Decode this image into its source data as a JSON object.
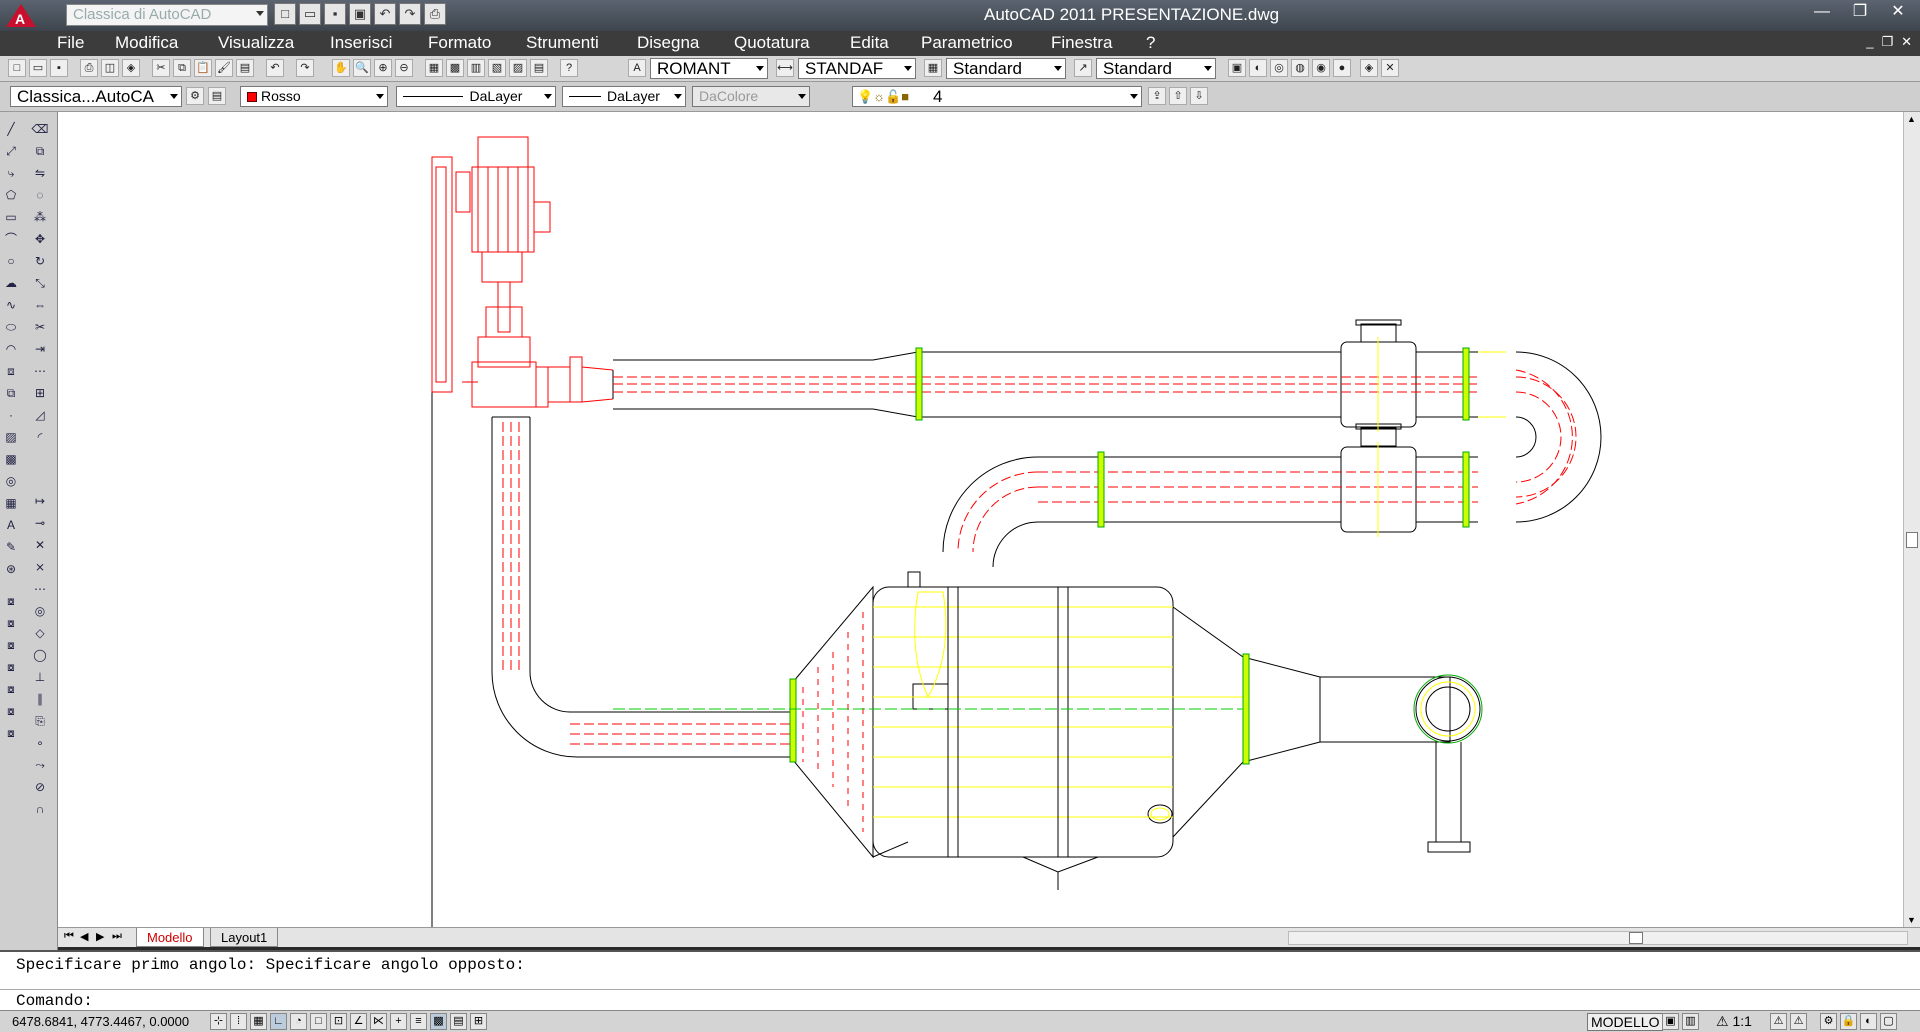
{
  "titlebar": {
    "workspace": "Classica di AutoCAD",
    "title": "AutoCAD 2011    PRESENTAZIONE.dwg",
    "qat_icons": [
      "new-icon",
      "open-icon",
      "save-icon",
      "saveas-icon",
      "undo-icon",
      "redo-icon",
      "print-icon"
    ]
  },
  "menu": {
    "items": [
      "File",
      "Modifica",
      "Visualizza",
      "Inserisci",
      "Formato",
      "Strumenti",
      "Disegna",
      "Quotatura",
      "Edita",
      "Parametrico",
      "Finestra",
      "?"
    ]
  },
  "toolbar1": {
    "text_style": "ROMANT",
    "dim_style": "STANDAF",
    "table_style": "Standard",
    "multileader_style": "Standard"
  },
  "toolbar2": {
    "workspace": "Classica...AutoCA",
    "color": "Rosso",
    "color_hex": "#ff0000",
    "linetype": "DaLayer",
    "lineweight": "DaLayer",
    "plotstyle": "DaColore",
    "layer": "4"
  },
  "tabs": {
    "model": "Modello",
    "layout": "Layout1"
  },
  "command": {
    "history": "Specificare primo angolo: Specificare angolo opposto:",
    "prompt": "Comando:"
  },
  "status": {
    "coords": "6478.6841,  4773.4467, 0.0000",
    "space": "MODELLO",
    "scale": "1:1"
  },
  "colors": {
    "accent_red": "#ff0000",
    "drawing_yellow": "#ffff00",
    "drawing_green": "#00ff00",
    "drawing_black": "#000000"
  }
}
